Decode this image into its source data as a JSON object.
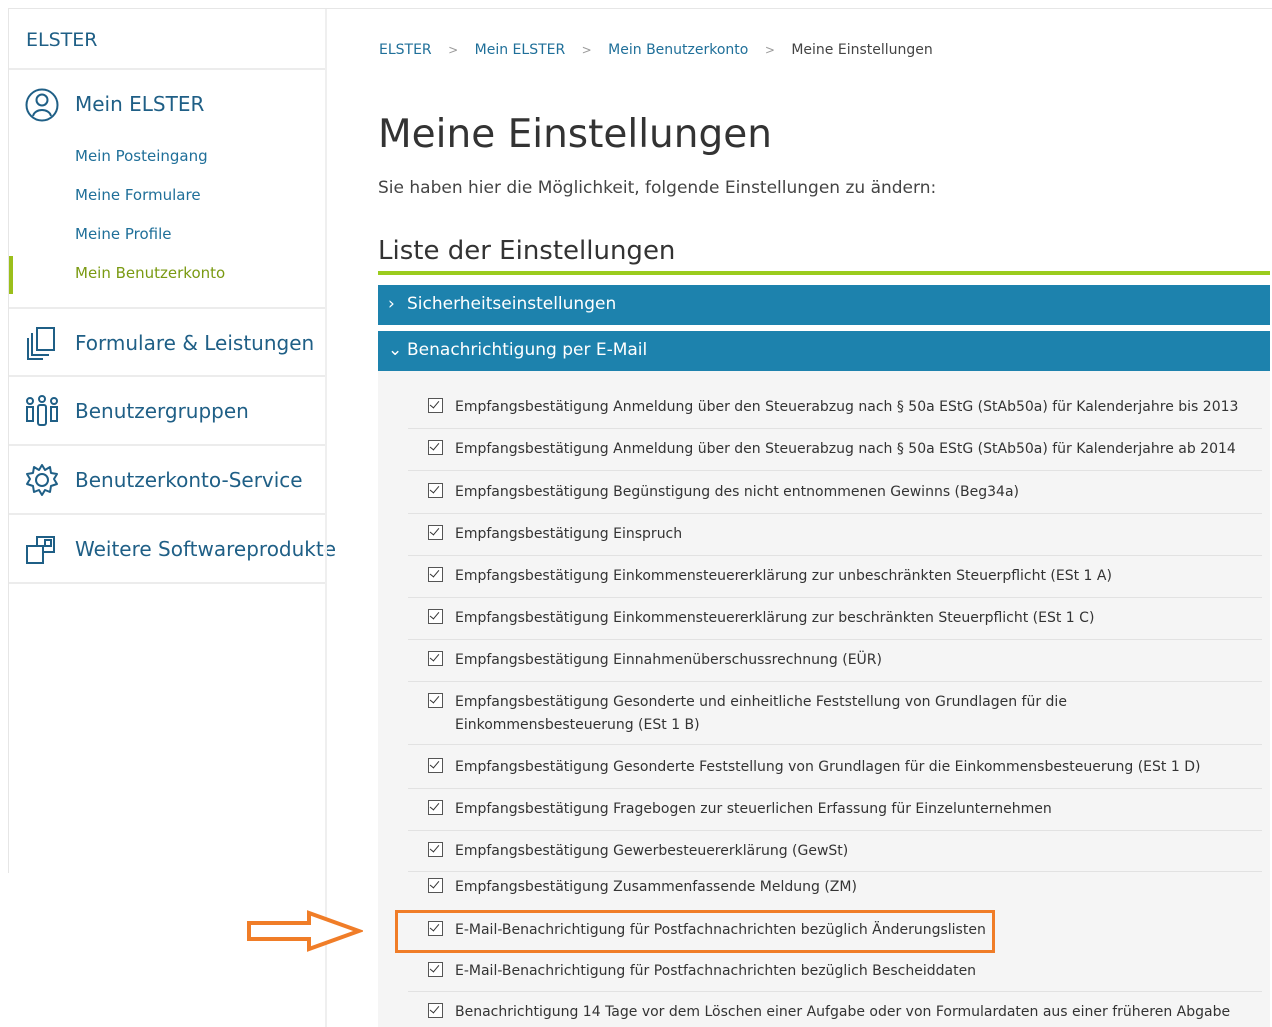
{
  "sidebar": {
    "brand": "ELSTER",
    "mein_elster": {
      "label": "Mein ELSTER",
      "icon": "person-circle-icon",
      "subitems": [
        {
          "label": "Mein Posteingang"
        },
        {
          "label": "Meine Formulare"
        },
        {
          "label": "Meine Profile"
        },
        {
          "label": "Mein Benutzerkonto",
          "active": true
        }
      ]
    },
    "sections": [
      {
        "label": "Formulare & Leistungen",
        "icon": "documents-icon"
      },
      {
        "label": "Benutzergruppen",
        "icon": "user-group-icon"
      },
      {
        "label": "Benutzerkonto-Service",
        "icon": "gear-icon"
      },
      {
        "label": "Weitere Softwareprodukte",
        "icon": "external-product-icon"
      }
    ]
  },
  "breadcrumb": [
    "ELSTER",
    "Mein ELSTER",
    "Mein Benutzerkonto",
    "Meine Einstellungen"
  ],
  "page": {
    "title": "Meine Einstellungen",
    "intro": "Sie haben hier die Möglichkeit, folgende Einstellungen zu ändern:",
    "list_title": "Liste der Einstellungen"
  },
  "accordion": [
    {
      "label": "Sicherheitseinstellungen",
      "expanded": false
    },
    {
      "label": "Benachrichtigung per E-Mail",
      "expanded": true
    }
  ],
  "settings": [
    {
      "label": "Empfangsbestätigung Anmeldung über den Steuerabzug nach § 50a EStG (StAb50a) für Kalenderjahre bis 2013",
      "checked": true
    },
    {
      "label": "Empfangsbestätigung Anmeldung über den Steuerabzug nach § 50a EStG (StAb50a) für Kalenderjahre ab 2014",
      "checked": true
    },
    {
      "label": "Empfangsbestätigung Begünstigung des nicht entnommenen Gewinns (Beg34a)",
      "checked": true
    },
    {
      "label": "Empfangsbestätigung Einspruch",
      "checked": true
    },
    {
      "label": "Empfangsbestätigung Einkommensteuererklärung zur unbeschränkten Steuerpflicht (ESt 1 A)",
      "checked": true
    },
    {
      "label": "Empfangsbestätigung Einkommensteuererklärung zur beschränkten Steuerpflicht (ESt 1 C)",
      "checked": true
    },
    {
      "label": "Empfangsbestätigung Einnahmenüberschussrechnung (EÜR)",
      "checked": true
    },
    {
      "label": "Empfangsbestätigung Gesonderte und einheitliche Feststellung von Grundlagen für die Einkommensbesteuerung (ESt 1 B)",
      "checked": true
    },
    {
      "label": "Empfangsbestätigung Gesonderte Feststellung von Grundlagen für die Einkommensbesteuerung (ESt 1 D)",
      "checked": true
    },
    {
      "label": "Empfangsbestätigung Fragebogen zur steuerlichen Erfassung für Einzelunternehmen",
      "checked": true
    },
    {
      "label": "Empfangsbestätigung Gewerbesteuererklärung (GewSt)",
      "checked": true
    },
    {
      "label": "Empfangsbestätigung Zusammenfassende Meldung (ZM)",
      "checked": true
    },
    {
      "label": "E-Mail-Benachrichtigung für Postfachnachrichten bezüglich Änderungslisten",
      "checked": true,
      "highlighted": true
    },
    {
      "label": "E-Mail-Benachrichtigung für Postfachnachrichten bezüglich Bescheiddaten",
      "checked": true
    },
    {
      "label": "Benachrichtigung 14 Tage vor dem Löschen einer Aufgabe oder von Formulardaten aus einer früheren Abgabe",
      "checked": true
    }
  ],
  "colors": {
    "accent_blue": "#1d82ad",
    "link_blue": "#1f6f99",
    "active_green": "#9bbf1b",
    "highlight_orange": "#f07d28"
  }
}
